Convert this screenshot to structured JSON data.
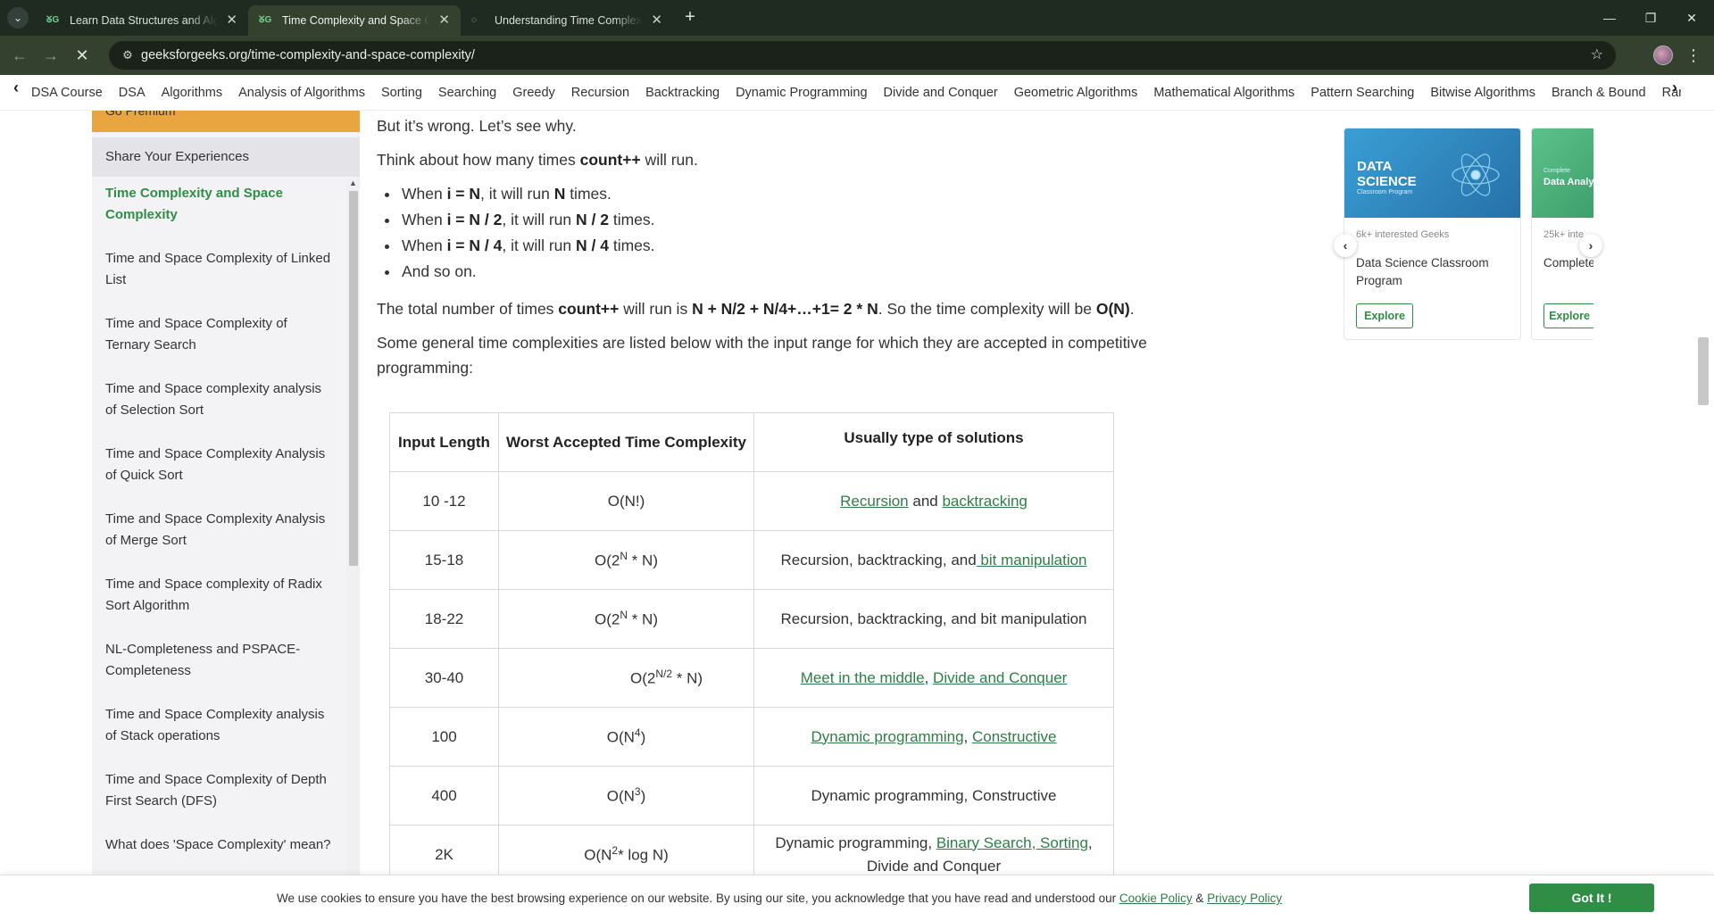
{
  "browser": {
    "tabs": [
      {
        "title": "Learn Data Structures and Algorithms",
        "favicon": "gfg-logo-icon",
        "active": false
      },
      {
        "title": "Time Complexity and Space Complexity",
        "favicon": "gfg-logo-icon",
        "active": true
      },
      {
        "title": "Understanding Time Complexity",
        "favicon": "loading-icon",
        "active": false
      }
    ],
    "url": "geeksforgeeks.org/time-complexity-and-space-complexity/",
    "accent": "#35412f"
  },
  "sitenav": {
    "items": [
      "DSA Course",
      "DSA",
      "Algorithms",
      "Analysis of Algorithms",
      "Sorting",
      "Searching",
      "Greedy",
      "Recursion",
      "Backtracking",
      "Dynamic Programming",
      "Divide and Conquer",
      "Geometric Algorithms",
      "Mathematical Algorithms",
      "Pattern Searching",
      "Bitwise Algorithms",
      "Branch & Bound",
      "Randomized"
    ]
  },
  "sidebar": {
    "premium_label": "Go Premium",
    "share_label": "Share Your Experiences",
    "items": [
      {
        "label": "Time Complexity and Space Complexity",
        "active": true
      },
      {
        "label": "Time and Space Complexity of Linked List"
      },
      {
        "label": "Time and Space Complexity of Ternary Search"
      },
      {
        "label": "Time and Space complexity analysis of Selection Sort"
      },
      {
        "label": "Time and Space Complexity Analysis of Quick Sort"
      },
      {
        "label": "Time and Space Complexity Analysis of Merge Sort"
      },
      {
        "label": "Time and Space complexity of Radix Sort Algorithm"
      },
      {
        "label": "NL-Completeness and PSPACE-Completeness"
      },
      {
        "label": "Time and Space Complexity analysis of Stack operations"
      },
      {
        "label": "Time and Space Complexity of Depth First Search (DFS)"
      },
      {
        "label": "What does 'Space Complexity' mean?"
      }
    ]
  },
  "article": {
    "p_wrong": "But it’s wrong. Let’s see why.",
    "p_think_a": "Think about how many times ",
    "p_think_b": "count++",
    "p_think_c": " will run.",
    "bullets": [
      {
        "a": "When ",
        "b": "i = N",
        "c": ", it will run ",
        "d": "N",
        "e": " times."
      },
      {
        "a": "When ",
        "b": "i = N / 2",
        "c": ", it will run ",
        "d": "N / 2",
        "e": " times."
      },
      {
        "a": "When ",
        "b": "i = N / 4",
        "c": ", it will run ",
        "d": "N / 4",
        "e": " times."
      },
      {
        "a": "And so on.",
        "b": "",
        "c": "",
        "d": "",
        "e": ""
      }
    ],
    "total": {
      "a": "The total number of times ",
      "b": "count++",
      "c": " will run is ",
      "d": "N + N/2 + N/4+…+1= 2 * N",
      "e": ". So the time complexity will be ",
      "f": "O(N)",
      "g": "."
    },
    "general": "Some general time complexities are listed below with the input range for which they are accepted in competitive programming:",
    "table": {
      "headers": [
        "Input Length",
        "Worst Accepted Time Complexity",
        "Usually type of solutions"
      ],
      "rows": [
        {
          "len": "10 -12",
          "cx": "O(N!)",
          "links": [
            "Recursion",
            "backtracking"
          ],
          "sep": " and "
        },
        {
          "len": "15-18",
          "cx_base": "O(2",
          "cx_sup": "N",
          "cx_tail": " * N)",
          "sol": "Recursion, backtracking, and",
          "link": " bit manipulation"
        },
        {
          "len": "18-22",
          "cx_base": "O(2",
          "cx_sup": "N",
          "cx_tail": " * N)",
          "sol": "Recursion, backtracking, and bit manipulation"
        },
        {
          "len": "30-40",
          "cx_base": "O(2",
          "cx_sup": "N/2",
          "cx_tail": " * N)",
          "links": [
            "Meet in the middle",
            "Divide and Conquer"
          ],
          "sep": ", "
        },
        {
          "len": "100",
          "cx_base": "O(N",
          "cx_sup": "4",
          "cx_tail": ")",
          "links": [
            "Dynamic programming",
            "Constructive"
          ],
          "sep": ", "
        },
        {
          "len": "400",
          "cx_base": "O(N",
          "cx_sup": "3",
          "cx_tail": ")",
          "sol": "Dynamic programming, Constructive"
        },
        {
          "len": "2K",
          "cx_base": "O(N",
          "cx_sup": "2",
          "cx_tail": "* log N)",
          "sol_a": "Dynamic programming, ",
          "link": "Binary Search, Sorting",
          "sol_b": ",",
          "sol_c": "Divide and Conquer"
        }
      ]
    }
  },
  "rail": {
    "cards": [
      {
        "banner_title": "DATA SCIENCE",
        "banner_sub": "Classroom Program",
        "interest": "6k+ interested Geeks",
        "name": "Data Science Classroom Program",
        "cta": "Explore",
        "color": "#2d7fb0"
      },
      {
        "banner_title": "Data Analy",
        "banner_sub": "Complete",
        "interest": "25k+ inte",
        "name": "Complete Program",
        "cta": "Explore",
        "color": "#4caf79"
      }
    ]
  },
  "cookie": {
    "text": "We use cookies to ensure you have the best browsing experience on our website. By using our site, you acknowledge that you have read and understood our ",
    "cookie_policy": "Cookie Policy",
    "amp": " & ",
    "privacy_policy": "Privacy Policy",
    "button": "Got It !"
  }
}
